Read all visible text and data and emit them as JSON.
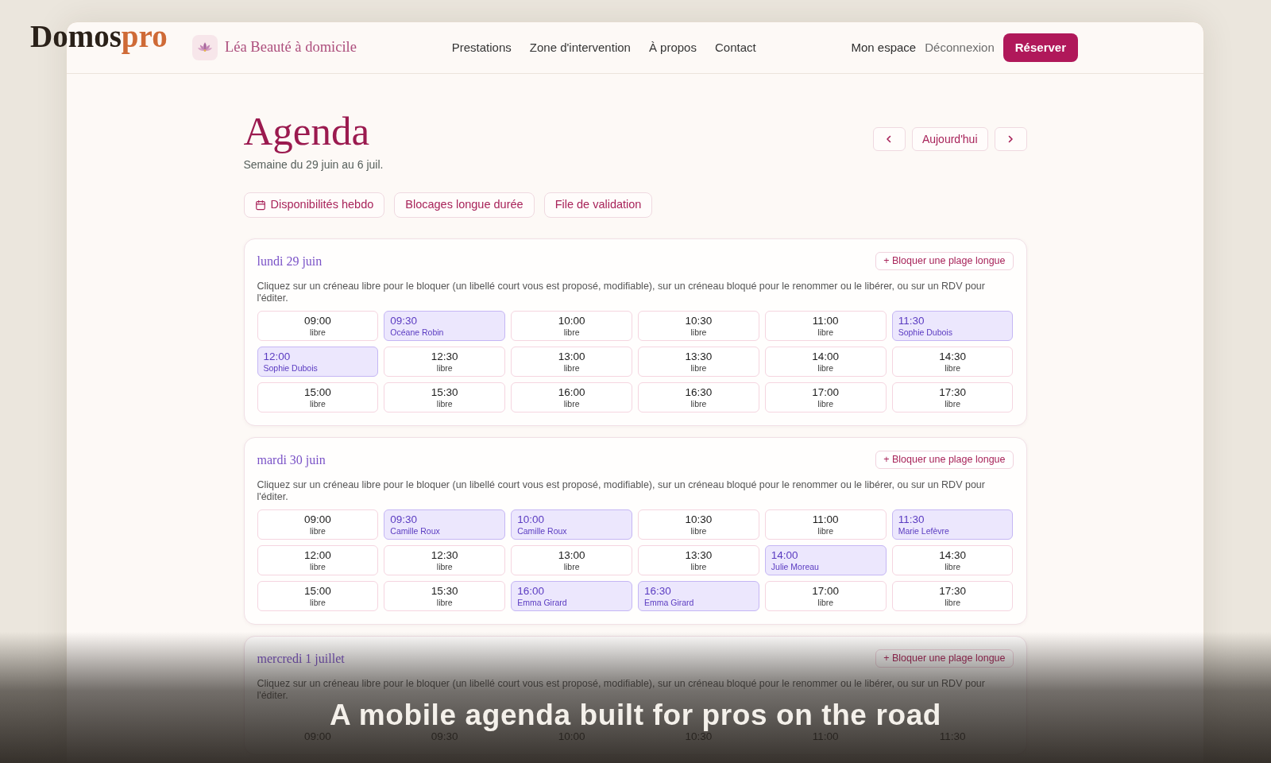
{
  "overlay": {
    "logo": {
      "text": "Domos",
      "accent": "pro"
    },
    "caption": "A mobile agenda built for pros on the road"
  },
  "header": {
    "brand": "Léa Beauté à domicile",
    "nav": [
      "Prestations",
      "Zone d'intervention",
      "À propos",
      "Contact"
    ],
    "account": "Mon espace",
    "logout": "Déconnexion",
    "cta": "Réserver"
  },
  "agenda": {
    "title": "Agenda",
    "subtitle": "Semaine du 29 juin au 6 juil.",
    "today": "Aujourd'hui",
    "tools": [
      {
        "label": "Disponibilités hebdo",
        "kind": "with_icon"
      },
      {
        "label": "Blocages longue durée",
        "kind": "plain"
      },
      {
        "label": "File de validation",
        "kind": "plain"
      }
    ],
    "days": [
      {
        "title": "lundi 29 juin",
        "action": "+ Bloquer une plage longue",
        "hint": "Cliquez sur un créneau libre pour le bloquer (un libellé court vous est proposé, modifiable), sur un créneau bloqué pour le renommer ou le libérer, ou sur un RDV pour l'éditer.",
        "slots": [
          {
            "time": "09:00",
            "kind": "free",
            "label": "libre"
          },
          {
            "time": "09:30",
            "kind": "booked",
            "label": "Océane Robin"
          },
          {
            "time": "10:00",
            "kind": "free",
            "label": "libre"
          },
          {
            "time": "10:30",
            "kind": "free",
            "label": "libre"
          },
          {
            "time": "11:00",
            "kind": "free",
            "label": "libre"
          },
          {
            "time": "11:30",
            "kind": "booked",
            "label": "Sophie Dubois"
          },
          {
            "time": "12:00",
            "kind": "booked",
            "label": "Sophie Dubois"
          },
          {
            "time": "12:30",
            "kind": "free",
            "label": "libre"
          },
          {
            "time": "13:00",
            "kind": "free",
            "label": "libre"
          },
          {
            "time": "13:30",
            "kind": "free",
            "label": "libre"
          },
          {
            "time": "14:00",
            "kind": "free",
            "label": "libre"
          },
          {
            "time": "14:30",
            "kind": "free",
            "label": "libre"
          },
          {
            "time": "15:00",
            "kind": "free",
            "label": "libre"
          },
          {
            "time": "15:30",
            "kind": "free",
            "label": "libre"
          },
          {
            "time": "16:00",
            "kind": "free",
            "label": "libre"
          },
          {
            "time": "16:30",
            "kind": "free",
            "label": "libre"
          },
          {
            "time": "17:00",
            "kind": "free",
            "label": "libre"
          },
          {
            "time": "17:30",
            "kind": "free",
            "label": "libre"
          }
        ]
      },
      {
        "title": "mardi 30 juin",
        "action": "+ Bloquer une plage longue",
        "hint": "Cliquez sur un créneau libre pour le bloquer (un libellé court vous est proposé, modifiable), sur un créneau bloqué pour le renommer ou le libérer, ou sur un RDV pour l'éditer.",
        "slots": [
          {
            "time": "09:00",
            "kind": "free",
            "label": "libre"
          },
          {
            "time": "09:30",
            "kind": "booked",
            "label": "Camille Roux"
          },
          {
            "time": "10:00",
            "kind": "booked",
            "label": "Camille Roux"
          },
          {
            "time": "10:30",
            "kind": "free",
            "label": "libre"
          },
          {
            "time": "11:00",
            "kind": "free",
            "label": "libre"
          },
          {
            "time": "11:30",
            "kind": "booked",
            "label": "Marie Lefèvre"
          },
          {
            "time": "12:00",
            "kind": "free",
            "label": "libre"
          },
          {
            "time": "12:30",
            "kind": "free",
            "label": "libre"
          },
          {
            "time": "13:00",
            "kind": "free",
            "label": "libre"
          },
          {
            "time": "13:30",
            "kind": "free",
            "label": "libre"
          },
          {
            "time": "14:00",
            "kind": "booked",
            "label": "Julie Moreau"
          },
          {
            "time": "14:30",
            "kind": "free",
            "label": "libre"
          },
          {
            "time": "15:00",
            "kind": "free",
            "label": "libre"
          },
          {
            "time": "15:30",
            "kind": "free",
            "label": "libre"
          },
          {
            "time": "16:00",
            "kind": "booked",
            "label": "Emma Girard"
          },
          {
            "time": "16:30",
            "kind": "booked",
            "label": "Emma Girard"
          },
          {
            "time": "17:00",
            "kind": "free",
            "label": "libre"
          },
          {
            "time": "17:30",
            "kind": "free",
            "label": "libre"
          }
        ]
      },
      {
        "title": "mercredi 1 juillet",
        "action": "+ Bloquer une plage longue",
        "hint": "Cliquez sur un créneau libre pour le bloquer (un libellé court vous est proposé, modifiable), sur un créneau bloqué pour le renommer ou le libérer, ou sur un RDV pour l'éditer.",
        "slots": [
          {
            "time": "09:00",
            "kind": "free"
          },
          {
            "time": "09:30",
            "kind": "free"
          },
          {
            "time": "10:00",
            "kind": "free"
          },
          {
            "time": "10:30",
            "kind": "free"
          },
          {
            "time": "11:00",
            "kind": "free"
          },
          {
            "time": "11:30",
            "kind": "free"
          }
        ]
      }
    ]
  }
}
